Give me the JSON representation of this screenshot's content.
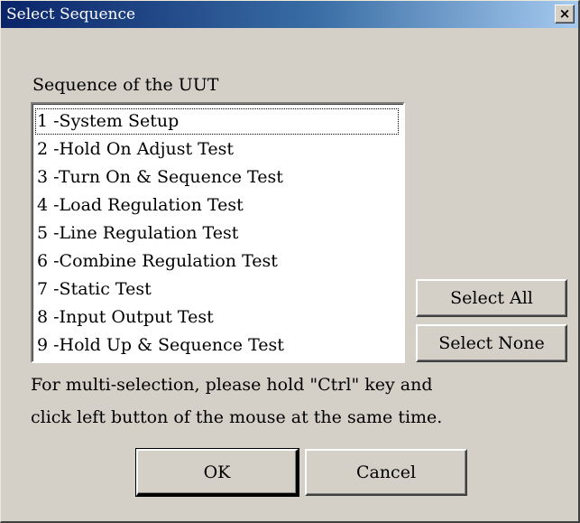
{
  "window": {
    "title": "Select Sequence",
    "close_glyph": "×"
  },
  "sequence": {
    "label": "Sequence of the UUT",
    "items": [
      "1 -System Setup",
      "2 -Hold On Adjust Test",
      "3 -Turn On & Sequence Test",
      "4 -Load Regulation Test",
      "5 -Line Regulation Test",
      "6 -Combine Regulation Test",
      "7 -Static Test",
      "8 -Input Output Test",
      "9 -Hold Up & Sequence Test"
    ],
    "focused_index": 0
  },
  "buttons": {
    "select_all": "Select All",
    "select_none": "Select None",
    "ok": "OK",
    "cancel": "Cancel"
  },
  "help": {
    "line1": "For multi-selection, please hold \"Ctrl\" key and",
    "line2": "click left button of the mouse at the same time."
  },
  "colors": {
    "dialog_face": "#d4d0c8",
    "titlebar_start": "#0a246a",
    "titlebar_end": "#a6caf0",
    "titlebar_text": "#ffffff",
    "list_background": "#ffffff"
  }
}
